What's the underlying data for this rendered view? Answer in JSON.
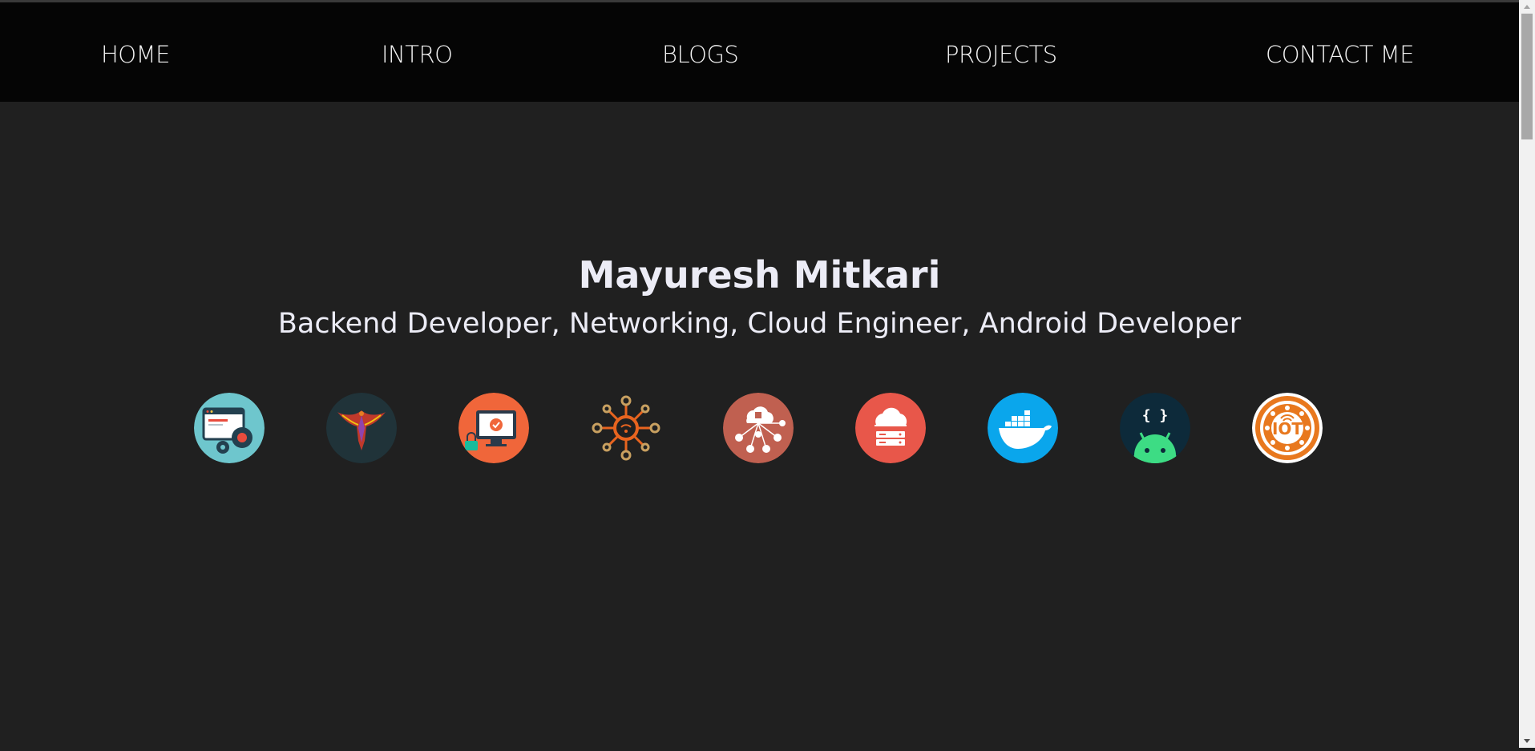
{
  "nav": {
    "items": [
      {
        "label": "HOME"
      },
      {
        "label": "INTRO"
      },
      {
        "label": "BLOGS"
      },
      {
        "label": "PROJECTS"
      },
      {
        "label": "CONTACT ME"
      }
    ]
  },
  "hero": {
    "name": "Mayuresh Mitkari",
    "roles": "Backend Developer, Networking, Cloud Engineer, Android Developer"
  },
  "skills": {
    "icons": [
      {
        "icon": "web-settings-icon"
      },
      {
        "icon": "kali-parrot-icon"
      },
      {
        "icon": "secure-computer-icon"
      },
      {
        "icon": "network-hub-icon"
      },
      {
        "icon": "cloud-network-icon"
      },
      {
        "icon": "cloud-server-icon"
      },
      {
        "icon": "docker-icon"
      },
      {
        "icon": "android-dev-icon"
      },
      {
        "icon": "iot-icon"
      }
    ]
  },
  "colors": {
    "navbar_bg": "#050505",
    "page_bg": "#202020",
    "text": "#ececf6"
  }
}
